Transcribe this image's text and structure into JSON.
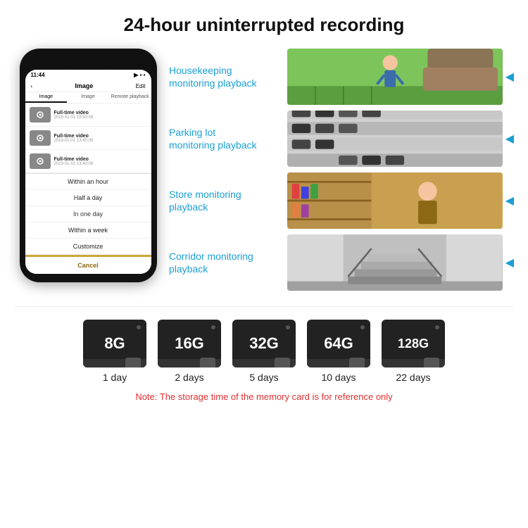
{
  "title": "24-hour uninterrupted recording",
  "phone": {
    "time": "11:44",
    "nav_back": "‹",
    "nav_title": "Image",
    "nav_edit": "Edit",
    "tabs": [
      "Image",
      "Image",
      "Remote playback"
    ],
    "list_items": [
      {
        "title": "Full-time video",
        "date": "2019-01-01 15:50:08"
      },
      {
        "title": "Full-time video",
        "date": "2019-01-01 13:45:08"
      },
      {
        "title": "Full-time video",
        "date": "2019-01-01 13:40:08"
      }
    ],
    "dropdown_items": [
      "Within an hour",
      "Half a day",
      "In one day",
      "Within a week",
      "Customize"
    ],
    "cancel_label": "Cancel"
  },
  "monitors": [
    {
      "label": "Housekeeping\nmonitoring playback",
      "img_type": "housekeeping"
    },
    {
      "label": "Parking lot\nmonitoring playback",
      "img_type": "parking"
    },
    {
      "label": "Store monitoring\nplayback",
      "img_type": "store"
    },
    {
      "label": "Corridor monitoring\nplayback",
      "img_type": "corridor"
    }
  ],
  "storage": {
    "cards": [
      {
        "size": "8G",
        "days": "1 day"
      },
      {
        "size": "16G",
        "days": "2 days"
      },
      {
        "size": "32G",
        "days": "5 days"
      },
      {
        "size": "64G",
        "days": "10 days"
      },
      {
        "size": "128G",
        "days": "22 days"
      }
    ],
    "note": "Note: The storage time of the memory card is for reference only"
  }
}
